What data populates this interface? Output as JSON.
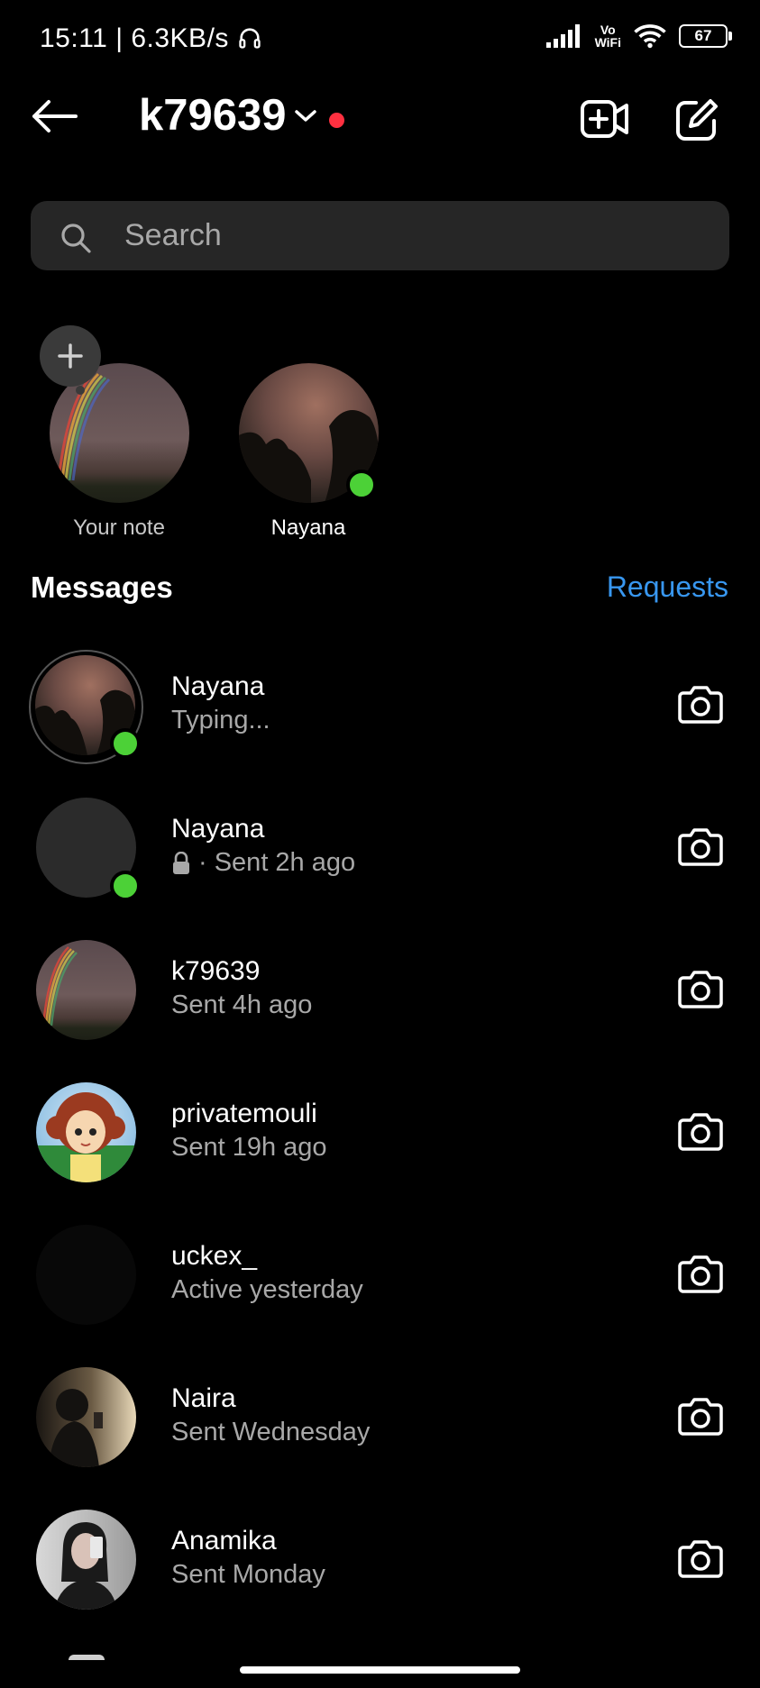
{
  "status_bar": {
    "time": "15:11",
    "speed": "6.3KB/s",
    "volte_top": "Vo",
    "volte_bottom": "WiFi",
    "battery": "67"
  },
  "header": {
    "title": "k79639",
    "back_icon": "arrow-left-icon",
    "video_icon": "new-video-call-icon",
    "compose_icon": "compose-icon"
  },
  "search": {
    "placeholder": "Search"
  },
  "notes": [
    {
      "label": "Your note",
      "add_icon": "plus-icon"
    },
    {
      "label": "Nayana",
      "online": true
    }
  ],
  "messages_header": {
    "title": "Messages",
    "requests": "Requests"
  },
  "threads": [
    {
      "name": "Nayana",
      "subtitle": "Typing...",
      "online": true
    },
    {
      "name": "Nayana",
      "subtitle": "· Sent 2h ago",
      "lock": true,
      "online": true
    },
    {
      "name": "k79639",
      "subtitle": "Sent 4h ago"
    },
    {
      "name": "privatemouli",
      "subtitle": "Sent 19h ago"
    },
    {
      "name": "uckex_",
      "subtitle": "Active yesterday"
    },
    {
      "name": "Naira",
      "subtitle": "Sent Wednesday"
    },
    {
      "name": "Anamika",
      "subtitle": "Sent Monday"
    }
  ],
  "colors": {
    "background": "#000000",
    "search_bg": "#262626",
    "link": "#3897f0",
    "online": "#4cd137",
    "notification": "#ff3040"
  }
}
